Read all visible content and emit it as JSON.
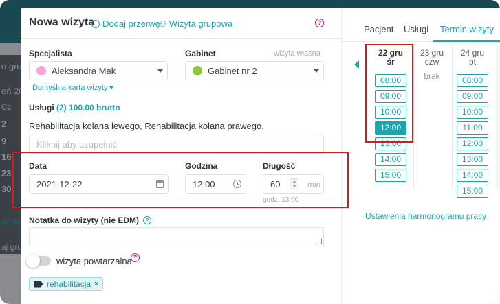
{
  "background": {
    "side_lines": [
      "o gru",
      "eń 20",
      "Cz"
    ],
    "days": [
      "2",
      "9",
      "16",
      "23",
      "30"
    ],
    "link_fragment": "dzisiaj",
    "bottom_text": "aj gru"
  },
  "modal": {
    "title": "Nowa wizyta",
    "add_break": "Dodaj przerwę",
    "group_visit": "Wizyta grupowa",
    "specialist": {
      "label": "Specjalista",
      "value": "Aleksandra Mak",
      "color": "#f6a5d5",
      "default_card": "Domyślna karta wizyty"
    },
    "office": {
      "label": "Gabinet",
      "own_visit": "wizyta własna",
      "value": "Gabinet nr 2",
      "color": "#8bc83a"
    },
    "services": {
      "label": "Usługi",
      "summary": "(2) 100.00 brutto",
      "text": "Rehabilitacja kolana lewego, Rehabilitacja kolana prawego,",
      "placeholder": "Kliknij aby uzupełnić"
    },
    "date": {
      "label": "Data",
      "value": "2021-12-22"
    },
    "time": {
      "label": "Godzina",
      "value": "12:00"
    },
    "duration": {
      "label": "Długość",
      "value": "60",
      "unit": "min",
      "end_hint": "godz. 13:00"
    },
    "note": {
      "label": "Notatka do wizyty (nie EDM)"
    },
    "recurring": {
      "label": "wizyta powtarzalna",
      "enabled": false
    },
    "tags": [
      {
        "label": "rehabilitacja"
      }
    ]
  },
  "right_panel": {
    "tabs": [
      "Pacjent",
      "Usługi",
      "Termin wizyty"
    ],
    "active_tab": "Termin wizyty",
    "days": [
      {
        "line1": "22 gru",
        "line2": "śr",
        "bold": true,
        "slots": [
          "08:00",
          "09:00",
          "10:00",
          "12:00",
          "13:00",
          "14:00",
          "15:00"
        ],
        "selected": "12:00"
      },
      {
        "line1": "23 gru",
        "line2": "czw",
        "bold": false,
        "slots": [],
        "empty": "brak"
      },
      {
        "line1": "24 gru",
        "line2": "pt",
        "bold": false,
        "slots": [
          "10:00",
          "08:00",
          "09:00",
          "10:00",
          "11:00",
          "12:00",
          "13:00",
          "14:00",
          "15:00"
        ]
      }
    ],
    "schedule_settings": "Ustawienia harmonogramu pracy"
  },
  "colors": {
    "accent": "#1aa6b0",
    "highlight_red": "#d8181f",
    "help_magenta": "#d0126d"
  }
}
